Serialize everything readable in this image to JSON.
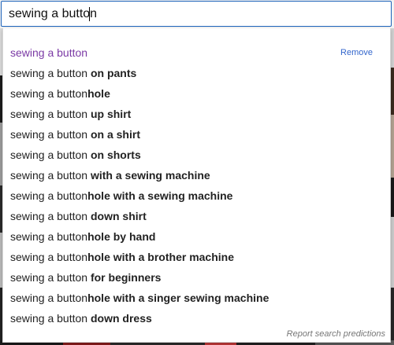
{
  "search": {
    "value": "sewing a button"
  },
  "dropdown": {
    "remove_label": "Remove",
    "report_label": "Report search predictions",
    "suggestions": [
      {
        "typed": "sewing a button",
        "completion": "",
        "history": true
      },
      {
        "typed": "sewing a button ",
        "completion": "on pants"
      },
      {
        "typed": "sewing a button",
        "completion": "hole"
      },
      {
        "typed": "sewing a button ",
        "completion": "up shirt"
      },
      {
        "typed": "sewing a button ",
        "completion": "on a shirt"
      },
      {
        "typed": "sewing a button ",
        "completion": "on shorts"
      },
      {
        "typed": "sewing a button ",
        "completion": "with a sewing machine"
      },
      {
        "typed": "sewing a button",
        "completion": "hole with a sewing machine"
      },
      {
        "typed": "sewing a button ",
        "completion": "down shirt"
      },
      {
        "typed": "sewing a button",
        "completion": "hole by hand"
      },
      {
        "typed": "sewing a button",
        "completion": "hole with a brother machine"
      },
      {
        "typed": "sewing a button ",
        "completion": "for beginners"
      },
      {
        "typed": "sewing a button",
        "completion": "hole with a singer sewing machine"
      },
      {
        "typed": "sewing a button ",
        "completion": "down dress"
      }
    ]
  },
  "colors": {
    "focus_border": "#1c62b9",
    "history_text": "#7b3aa5",
    "link": "#3366cc"
  }
}
